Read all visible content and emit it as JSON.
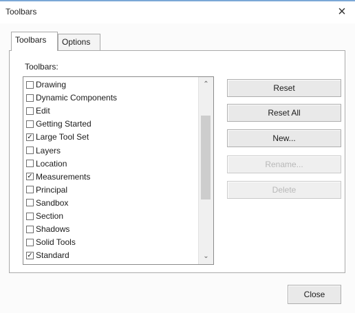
{
  "window": {
    "title": "Toolbars",
    "close_glyph": "×"
  },
  "tabs": [
    {
      "label": "Toolbars"
    },
    {
      "label": "Options"
    }
  ],
  "panel": {
    "group_label": "Toolbars:"
  },
  "toolbar_list": [
    {
      "label": "Drawing",
      "checked": false
    },
    {
      "label": "Dynamic Components",
      "checked": false
    },
    {
      "label": "Edit",
      "checked": false
    },
    {
      "label": "Getting Started",
      "checked": false
    },
    {
      "label": "Large Tool Set",
      "checked": true
    },
    {
      "label": "Layers",
      "checked": false
    },
    {
      "label": "Location",
      "checked": false
    },
    {
      "label": "Measurements",
      "checked": true
    },
    {
      "label": "Principal",
      "checked": false
    },
    {
      "label": "Sandbox",
      "checked": false
    },
    {
      "label": "Section",
      "checked": false
    },
    {
      "label": "Shadows",
      "checked": false
    },
    {
      "label": "Solid Tools",
      "checked": false
    },
    {
      "label": "Standard",
      "checked": true
    }
  ],
  "scroll": {
    "up_glyph": "⌃",
    "down_glyph": "⌄"
  },
  "buttons": {
    "reset": "Reset",
    "reset_all": "Reset All",
    "new": "New...",
    "rename": "Rename...",
    "delete": "Delete",
    "close": "Close"
  },
  "check_glyph": "✓"
}
